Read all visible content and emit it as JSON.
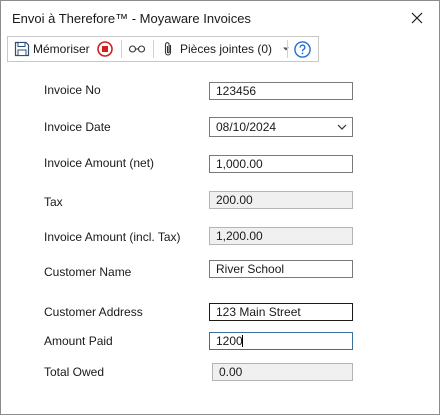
{
  "window": {
    "title": "Envoi à Therefore™ - Moyaware Invoices"
  },
  "toolbar": {
    "save_label": "Mémoriser",
    "attachments_label": "Pièces jointes (0)"
  },
  "form": {
    "invoice_no": {
      "label": "Invoice No",
      "value": "123456"
    },
    "invoice_date": {
      "label": "Invoice Date",
      "value": "08/10/2024"
    },
    "invoice_amount_net": {
      "label": "Invoice Amount (net)",
      "value": "1,000.00"
    },
    "tax": {
      "label": "Tax",
      "value": "200.00"
    },
    "invoice_amount_incl": {
      "label": "Invoice Amount (incl. Tax)",
      "value": "1,200.00"
    },
    "customer_name": {
      "label": "Customer Name",
      "value": "River School"
    },
    "customer_address": {
      "label": "Customer Address",
      "value": "123 Main Street"
    },
    "amount_paid": {
      "label": "Amount Paid",
      "value": "1200"
    },
    "total_owed": {
      "label": "Total Owed",
      "value": "0.00"
    }
  },
  "icons": {
    "close": "close-icon",
    "save": "save-icon",
    "stop": "stop-icon",
    "glasses": "glasses-icon",
    "paperclip": "paperclip-icon",
    "dropdown": "chevron-down-icon",
    "help": "help-icon"
  },
  "colors": {
    "stop_red": "#d21f1f",
    "help_blue": "#1f6fd0",
    "readonly_bg": "#f0f0f0"
  }
}
